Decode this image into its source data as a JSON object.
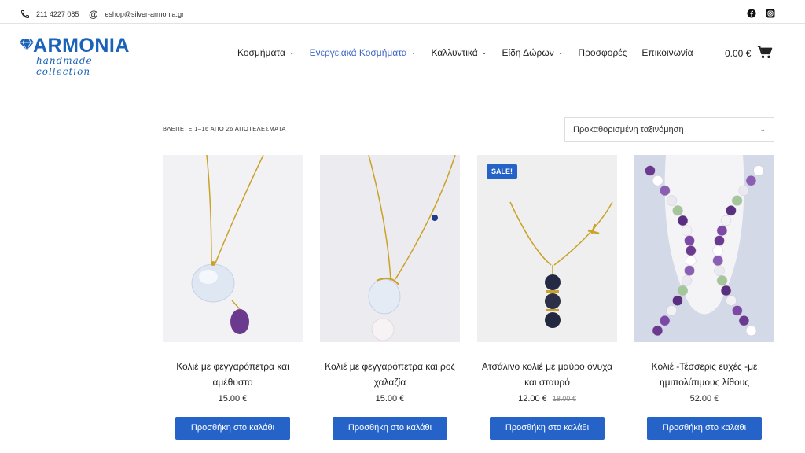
{
  "topbar": {
    "phone": "211 4227 085",
    "email": "eshop@silver-armonia.gr",
    "social_icons": [
      "facebook-icon",
      "instagram-icon"
    ]
  },
  "logo": {
    "brand": "ARMONIA",
    "tagline": "handmade collection"
  },
  "nav": {
    "items": [
      {
        "label": "Κοσμήματα",
        "has_dropdown": true
      },
      {
        "label": "Ενεργειακά Κοσμήματα",
        "has_dropdown": true,
        "active": true
      },
      {
        "label": "Καλλυντικά",
        "has_dropdown": true
      },
      {
        "label": "Είδη Δώρων",
        "has_dropdown": true
      },
      {
        "label": "Προσφορές",
        "has_dropdown": false
      },
      {
        "label": "Επικοινωνία",
        "has_dropdown": false
      }
    ],
    "cart_total": "0.00 €"
  },
  "shop": {
    "result_count": "ΒΛΕΠΕΤΕ 1–16 ΑΠΟ 26 ΑΠΟΤΕΛΕΣΜΑΤΑ",
    "sort_selected": "Προκαθορισμένη ταξινόμηση"
  },
  "products": [
    {
      "title": "Κολιέ με φεγγαρόπετρα και αμέθυστο",
      "price": "15.00 €",
      "button": "Προσθήκη στο καλάθι"
    },
    {
      "title": "Κολιέ με φεγγαρόπετρα και ροζ χαλαζία",
      "price": "15.00 €",
      "button": "Προσθήκη στο καλάθι"
    },
    {
      "title": "Ατσάλινο κολιέ με μαύρο όνυχα και σταυρό",
      "price": "12.00 €",
      "old_price": "18.00 €",
      "badge": "SALE!",
      "button": "Προσθήκη στο καλάθι"
    },
    {
      "title": "Κολιέ -Τέσσερις ευχές -με ημιπολύτιμους λίθους",
      "price": "52.00 €",
      "button": "Προσθήκη στο καλάθι"
    }
  ],
  "colors": {
    "accent": "#2563c9",
    "brand": "#1a63b8",
    "active_nav": "#3d66c8"
  }
}
